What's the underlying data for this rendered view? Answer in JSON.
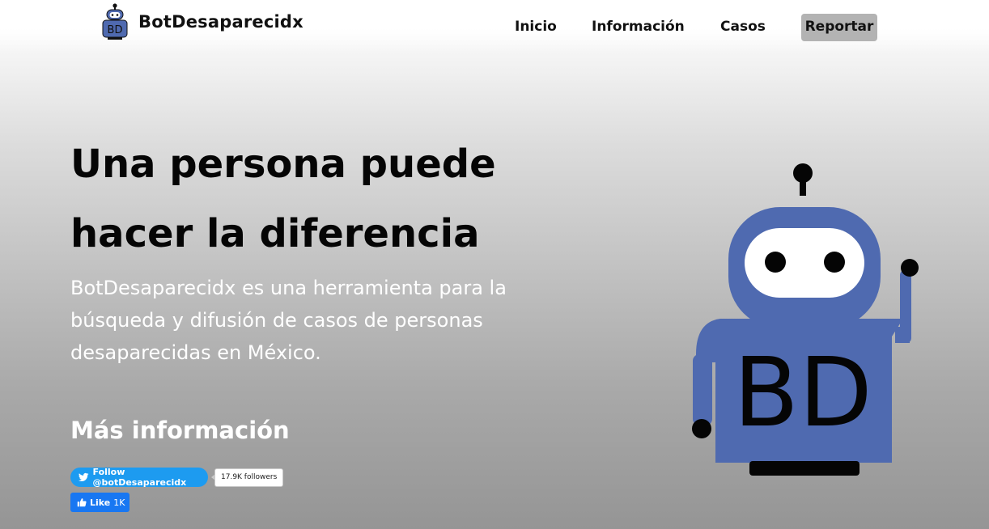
{
  "header": {
    "brand_name": "BotDesaparecidx",
    "logo_text": "BD",
    "nav": {
      "inicio": "Inicio",
      "informacion": "Información",
      "casos": "Casos",
      "reportar": "Reportar"
    }
  },
  "hero": {
    "title_line1": "Una persona puede",
    "title_line2": "hacer la diferencia",
    "description": "BotDesaparecidx es una herramienta para la búsqueda y difusión de casos de personas desaparecidas en México.",
    "more_info": "Más información"
  },
  "social": {
    "twitter_follow": "Follow @botDesaparecidx",
    "twitter_followers": "17.9K followers",
    "fb_like": "Like",
    "fb_count": "1K"
  },
  "robot_illustration": {
    "chest_text": "BD"
  },
  "colors": {
    "robot_blue": "#4f6ab0",
    "reportar_bg": "#b3b3b3",
    "twitter_blue": "#1d9bf0",
    "facebook_blue": "#1877f2"
  }
}
